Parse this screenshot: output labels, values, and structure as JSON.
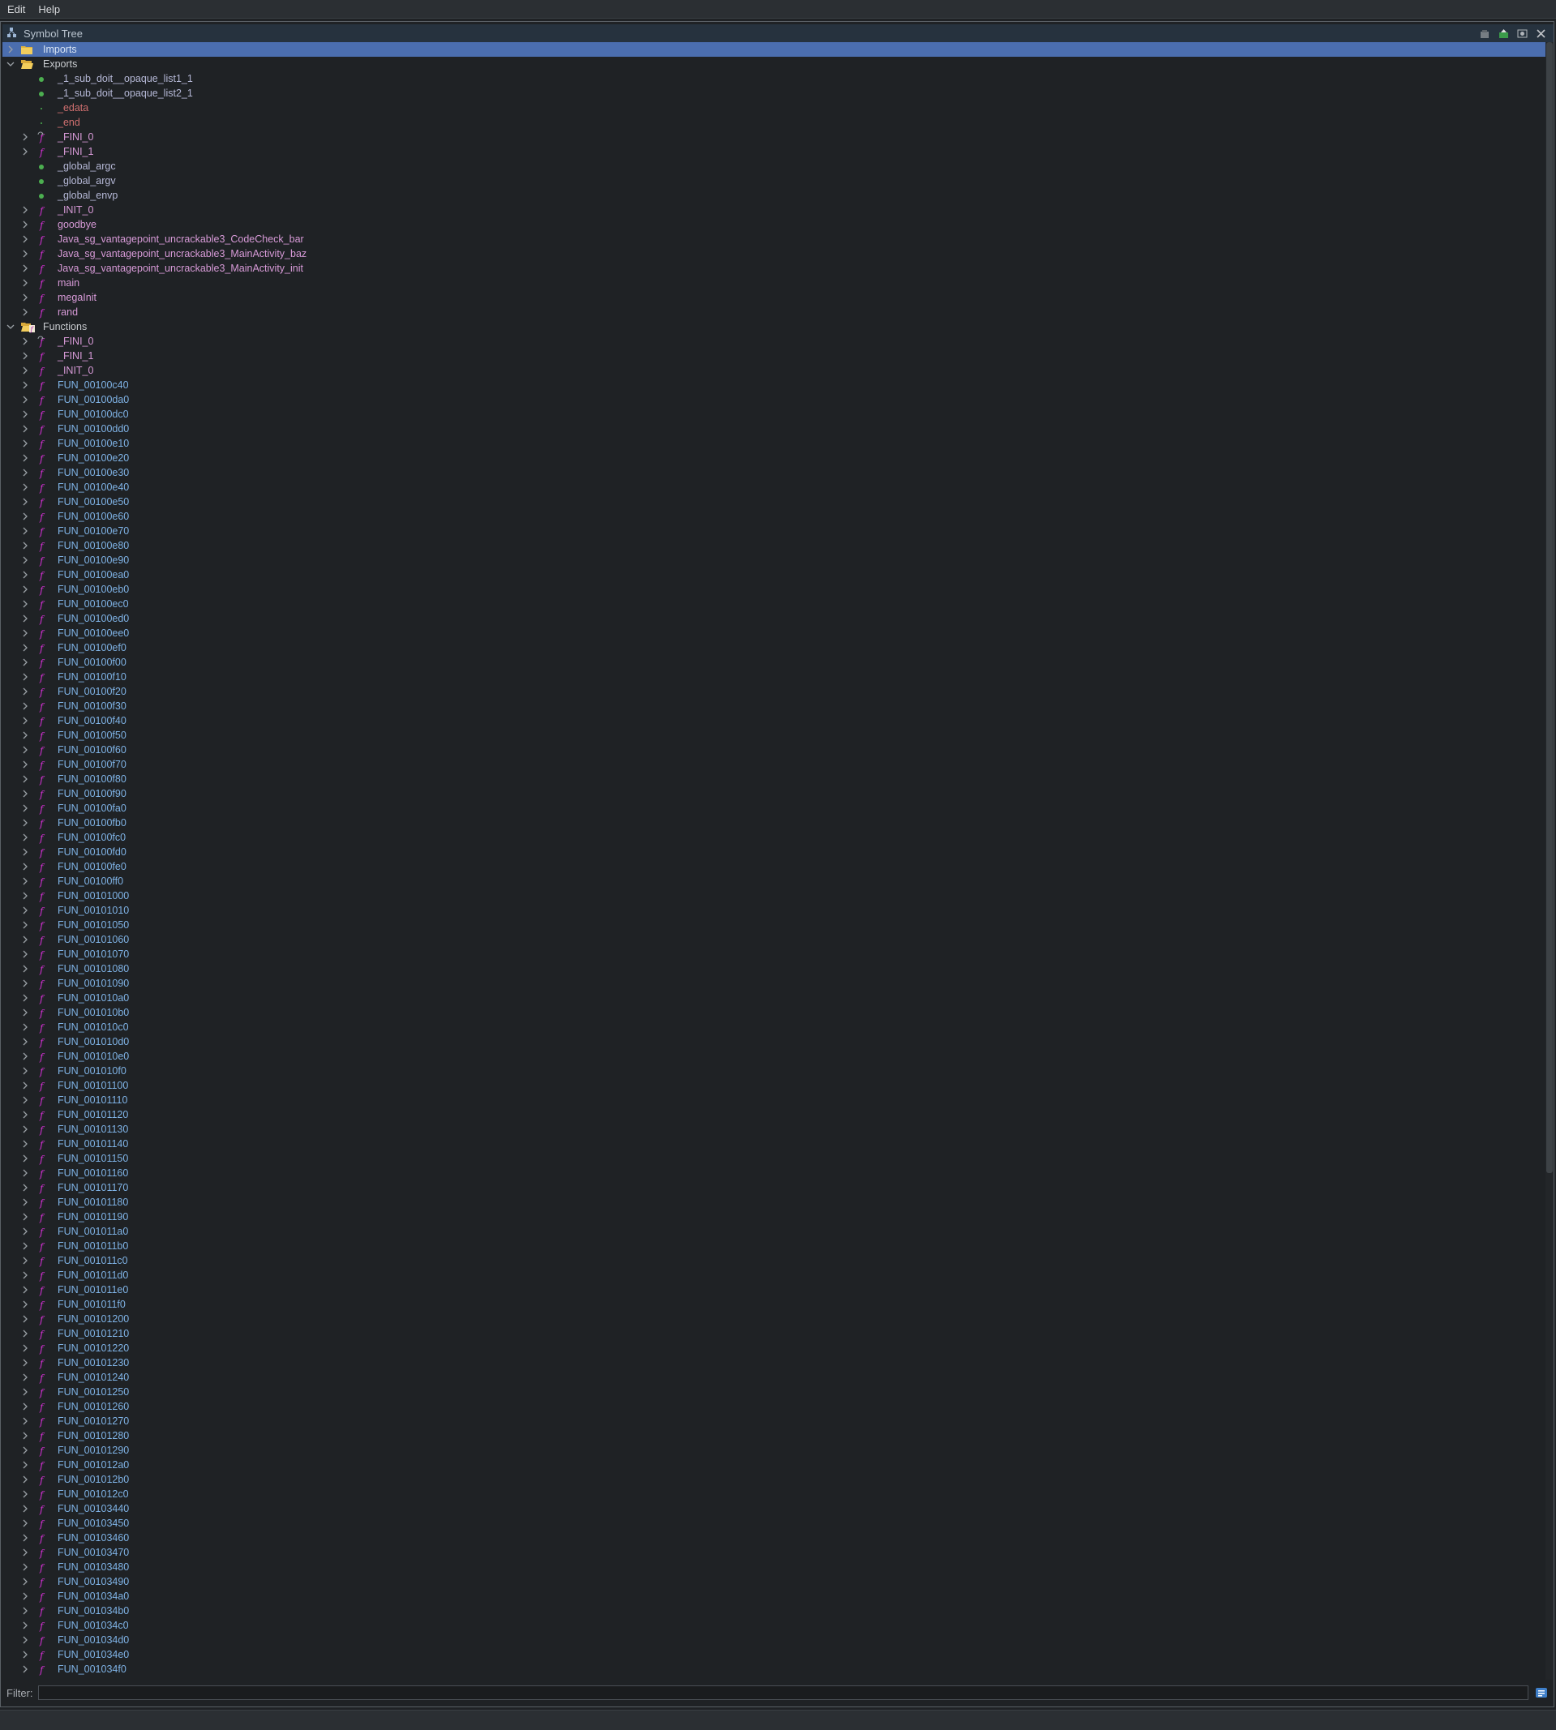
{
  "menu": [
    "Edit",
    "Help"
  ],
  "panel": {
    "title": "Symbol Tree"
  },
  "filter": {
    "label": "Filter:",
    "value": ""
  },
  "colors": {
    "selection": "#4b6eaf",
    "function_icon": "#d030d0",
    "data_dot": "#4caf50",
    "fun_text": "#7fb3e6"
  },
  "tree": [
    {
      "level": 0,
      "label": "Imports",
      "expand": "collapsed",
      "icon": "folder-closed-icon",
      "style": "sel",
      "selected": true
    },
    {
      "level": 0,
      "label": "Exports",
      "expand": "expanded",
      "icon": "folder-open-icon",
      "style": "folder"
    },
    {
      "level": 1,
      "label": "_1_sub_doit__opaque_list1_1",
      "expand": "none",
      "icon": "green-dot-icon",
      "style": "label"
    },
    {
      "level": 1,
      "label": "_1_sub_doit__opaque_list2_1",
      "expand": "none",
      "icon": "green-dot-icon",
      "style": "label"
    },
    {
      "level": 1,
      "label": "_edata",
      "expand": "none",
      "icon": "small-dot-icon",
      "style": "red"
    },
    {
      "level": 1,
      "label": "_end",
      "expand": "none",
      "icon": "small-dot-icon",
      "style": "red"
    },
    {
      "level": 1,
      "label": "_FINI_0",
      "expand": "collapsed",
      "icon": "function-thunk-icon",
      "style": "func"
    },
    {
      "level": 1,
      "label": "_FINI_1",
      "expand": "collapsed",
      "icon": "function-icon",
      "style": "func"
    },
    {
      "level": 1,
      "label": "_global_argc",
      "expand": "none",
      "icon": "green-dot-icon",
      "style": "label"
    },
    {
      "level": 1,
      "label": "_global_argv",
      "expand": "none",
      "icon": "green-dot-icon",
      "style": "label"
    },
    {
      "level": 1,
      "label": "_global_envp",
      "expand": "none",
      "icon": "green-dot-icon",
      "style": "label"
    },
    {
      "level": 1,
      "label": "_INIT_0",
      "expand": "collapsed",
      "icon": "function-icon",
      "style": "func"
    },
    {
      "level": 1,
      "label": "goodbye",
      "expand": "collapsed",
      "icon": "function-icon",
      "style": "func"
    },
    {
      "level": 1,
      "label": "Java_sg_vantagepoint_uncrackable3_CodeCheck_bar",
      "expand": "collapsed",
      "icon": "function-icon",
      "style": "func"
    },
    {
      "level": 1,
      "label": "Java_sg_vantagepoint_uncrackable3_MainActivity_baz",
      "expand": "collapsed",
      "icon": "function-icon",
      "style": "func"
    },
    {
      "level": 1,
      "label": "Java_sg_vantagepoint_uncrackable3_MainActivity_init",
      "expand": "collapsed",
      "icon": "function-icon",
      "style": "func"
    },
    {
      "level": 1,
      "label": "main",
      "expand": "collapsed",
      "icon": "function-icon",
      "style": "func"
    },
    {
      "level": 1,
      "label": "megaInit",
      "expand": "collapsed",
      "icon": "function-icon",
      "style": "func"
    },
    {
      "level": 1,
      "label": "rand",
      "expand": "collapsed",
      "icon": "function-icon",
      "style": "func"
    },
    {
      "level": 0,
      "label": "Functions",
      "expand": "expanded",
      "icon": "functions-folder-icon",
      "style": "folder"
    },
    {
      "level": 1,
      "label": "_FINI_0",
      "expand": "collapsed",
      "icon": "function-thunk-icon",
      "style": "func"
    },
    {
      "level": 1,
      "label": "_FINI_1",
      "expand": "collapsed",
      "icon": "function-icon",
      "style": "func"
    },
    {
      "level": 1,
      "label": "_INIT_0",
      "expand": "collapsed",
      "icon": "function-icon",
      "style": "func"
    },
    {
      "level": 1,
      "label": "FUN_00100c40",
      "expand": "collapsed",
      "icon": "function-icon",
      "style": "fun"
    },
    {
      "level": 1,
      "label": "FUN_00100da0",
      "expand": "collapsed",
      "icon": "function-icon",
      "style": "fun"
    },
    {
      "level": 1,
      "label": "FUN_00100dc0",
      "expand": "collapsed",
      "icon": "function-icon",
      "style": "fun"
    },
    {
      "level": 1,
      "label": "FUN_00100dd0",
      "expand": "collapsed",
      "icon": "function-icon",
      "style": "fun"
    },
    {
      "level": 1,
      "label": "FUN_00100e10",
      "expand": "collapsed",
      "icon": "function-icon",
      "style": "fun"
    },
    {
      "level": 1,
      "label": "FUN_00100e20",
      "expand": "collapsed",
      "icon": "function-icon",
      "style": "fun"
    },
    {
      "level": 1,
      "label": "FUN_00100e30",
      "expand": "collapsed",
      "icon": "function-icon",
      "style": "fun"
    },
    {
      "level": 1,
      "label": "FUN_00100e40",
      "expand": "collapsed",
      "icon": "function-icon",
      "style": "fun"
    },
    {
      "level": 1,
      "label": "FUN_00100e50",
      "expand": "collapsed",
      "icon": "function-icon",
      "style": "fun"
    },
    {
      "level": 1,
      "label": "FUN_00100e60",
      "expand": "collapsed",
      "icon": "function-icon",
      "style": "fun"
    },
    {
      "level": 1,
      "label": "FUN_00100e70",
      "expand": "collapsed",
      "icon": "function-icon",
      "style": "fun"
    },
    {
      "level": 1,
      "label": "FUN_00100e80",
      "expand": "collapsed",
      "icon": "function-icon",
      "style": "fun"
    },
    {
      "level": 1,
      "label": "FUN_00100e90",
      "expand": "collapsed",
      "icon": "function-icon",
      "style": "fun"
    },
    {
      "level": 1,
      "label": "FUN_00100ea0",
      "expand": "collapsed",
      "icon": "function-icon",
      "style": "fun"
    },
    {
      "level": 1,
      "label": "FUN_00100eb0",
      "expand": "collapsed",
      "icon": "function-icon",
      "style": "fun"
    },
    {
      "level": 1,
      "label": "FUN_00100ec0",
      "expand": "collapsed",
      "icon": "function-icon",
      "style": "fun"
    },
    {
      "level": 1,
      "label": "FUN_00100ed0",
      "expand": "collapsed",
      "icon": "function-icon",
      "style": "fun"
    },
    {
      "level": 1,
      "label": "FUN_00100ee0",
      "expand": "collapsed",
      "icon": "function-icon",
      "style": "fun"
    },
    {
      "level": 1,
      "label": "FUN_00100ef0",
      "expand": "collapsed",
      "icon": "function-icon",
      "style": "fun"
    },
    {
      "level": 1,
      "label": "FUN_00100f00",
      "expand": "collapsed",
      "icon": "function-icon",
      "style": "fun"
    },
    {
      "level": 1,
      "label": "FUN_00100f10",
      "expand": "collapsed",
      "icon": "function-icon",
      "style": "fun"
    },
    {
      "level": 1,
      "label": "FUN_00100f20",
      "expand": "collapsed",
      "icon": "function-icon",
      "style": "fun"
    },
    {
      "level": 1,
      "label": "FUN_00100f30",
      "expand": "collapsed",
      "icon": "function-icon",
      "style": "fun"
    },
    {
      "level": 1,
      "label": "FUN_00100f40",
      "expand": "collapsed",
      "icon": "function-icon",
      "style": "fun"
    },
    {
      "level": 1,
      "label": "FUN_00100f50",
      "expand": "collapsed",
      "icon": "function-icon",
      "style": "fun"
    },
    {
      "level": 1,
      "label": "FUN_00100f60",
      "expand": "collapsed",
      "icon": "function-icon",
      "style": "fun"
    },
    {
      "level": 1,
      "label": "FUN_00100f70",
      "expand": "collapsed",
      "icon": "function-icon",
      "style": "fun"
    },
    {
      "level": 1,
      "label": "FUN_00100f80",
      "expand": "collapsed",
      "icon": "function-icon",
      "style": "fun"
    },
    {
      "level": 1,
      "label": "FUN_00100f90",
      "expand": "collapsed",
      "icon": "function-icon",
      "style": "fun"
    },
    {
      "level": 1,
      "label": "FUN_00100fa0",
      "expand": "collapsed",
      "icon": "function-icon",
      "style": "fun"
    },
    {
      "level": 1,
      "label": "FUN_00100fb0",
      "expand": "collapsed",
      "icon": "function-icon",
      "style": "fun"
    },
    {
      "level": 1,
      "label": "FUN_00100fc0",
      "expand": "collapsed",
      "icon": "function-icon",
      "style": "fun"
    },
    {
      "level": 1,
      "label": "FUN_00100fd0",
      "expand": "collapsed",
      "icon": "function-icon",
      "style": "fun"
    },
    {
      "level": 1,
      "label": "FUN_00100fe0",
      "expand": "collapsed",
      "icon": "function-icon",
      "style": "fun"
    },
    {
      "level": 1,
      "label": "FUN_00100ff0",
      "expand": "collapsed",
      "icon": "function-icon",
      "style": "fun"
    },
    {
      "level": 1,
      "label": "FUN_00101000",
      "expand": "collapsed",
      "icon": "function-icon",
      "style": "fun"
    },
    {
      "level": 1,
      "label": "FUN_00101010",
      "expand": "collapsed",
      "icon": "function-icon",
      "style": "fun"
    },
    {
      "level": 1,
      "label": "FUN_00101050",
      "expand": "collapsed",
      "icon": "function-icon",
      "style": "fun"
    },
    {
      "level": 1,
      "label": "FUN_00101060",
      "expand": "collapsed",
      "icon": "function-icon",
      "style": "fun"
    },
    {
      "level": 1,
      "label": "FUN_00101070",
      "expand": "collapsed",
      "icon": "function-icon",
      "style": "fun"
    },
    {
      "level": 1,
      "label": "FUN_00101080",
      "expand": "collapsed",
      "icon": "function-icon",
      "style": "fun"
    },
    {
      "level": 1,
      "label": "FUN_00101090",
      "expand": "collapsed",
      "icon": "function-icon",
      "style": "fun"
    },
    {
      "level": 1,
      "label": "FUN_001010a0",
      "expand": "collapsed",
      "icon": "function-icon",
      "style": "fun"
    },
    {
      "level": 1,
      "label": "FUN_001010b0",
      "expand": "collapsed",
      "icon": "function-icon",
      "style": "fun"
    },
    {
      "level": 1,
      "label": "FUN_001010c0",
      "expand": "collapsed",
      "icon": "function-icon",
      "style": "fun"
    },
    {
      "level": 1,
      "label": "FUN_001010d0",
      "expand": "collapsed",
      "icon": "function-icon",
      "style": "fun"
    },
    {
      "level": 1,
      "label": "FUN_001010e0",
      "expand": "collapsed",
      "icon": "function-icon",
      "style": "fun"
    },
    {
      "level": 1,
      "label": "FUN_001010f0",
      "expand": "collapsed",
      "icon": "function-icon",
      "style": "fun"
    },
    {
      "level": 1,
      "label": "FUN_00101100",
      "expand": "collapsed",
      "icon": "function-icon",
      "style": "fun"
    },
    {
      "level": 1,
      "label": "FUN_00101110",
      "expand": "collapsed",
      "icon": "function-icon",
      "style": "fun"
    },
    {
      "level": 1,
      "label": "FUN_00101120",
      "expand": "collapsed",
      "icon": "function-icon",
      "style": "fun"
    },
    {
      "level": 1,
      "label": "FUN_00101130",
      "expand": "collapsed",
      "icon": "function-icon",
      "style": "fun"
    },
    {
      "level": 1,
      "label": "FUN_00101140",
      "expand": "collapsed",
      "icon": "function-icon",
      "style": "fun"
    },
    {
      "level": 1,
      "label": "FUN_00101150",
      "expand": "collapsed",
      "icon": "function-icon",
      "style": "fun"
    },
    {
      "level": 1,
      "label": "FUN_00101160",
      "expand": "collapsed",
      "icon": "function-icon",
      "style": "fun"
    },
    {
      "level": 1,
      "label": "FUN_00101170",
      "expand": "collapsed",
      "icon": "function-icon",
      "style": "fun"
    },
    {
      "level": 1,
      "label": "FUN_00101180",
      "expand": "collapsed",
      "icon": "function-icon",
      "style": "fun"
    },
    {
      "level": 1,
      "label": "FUN_00101190",
      "expand": "collapsed",
      "icon": "function-icon",
      "style": "fun"
    },
    {
      "level": 1,
      "label": "FUN_001011a0",
      "expand": "collapsed",
      "icon": "function-icon",
      "style": "fun"
    },
    {
      "level": 1,
      "label": "FUN_001011b0",
      "expand": "collapsed",
      "icon": "function-icon",
      "style": "fun"
    },
    {
      "level": 1,
      "label": "FUN_001011c0",
      "expand": "collapsed",
      "icon": "function-icon",
      "style": "fun"
    },
    {
      "level": 1,
      "label": "FUN_001011d0",
      "expand": "collapsed",
      "icon": "function-icon",
      "style": "fun"
    },
    {
      "level": 1,
      "label": "FUN_001011e0",
      "expand": "collapsed",
      "icon": "function-icon",
      "style": "fun"
    },
    {
      "level": 1,
      "label": "FUN_001011f0",
      "expand": "collapsed",
      "icon": "function-icon",
      "style": "fun"
    },
    {
      "level": 1,
      "label": "FUN_00101200",
      "expand": "collapsed",
      "icon": "function-icon",
      "style": "fun"
    },
    {
      "level": 1,
      "label": "FUN_00101210",
      "expand": "collapsed",
      "icon": "function-icon",
      "style": "fun"
    },
    {
      "level": 1,
      "label": "FUN_00101220",
      "expand": "collapsed",
      "icon": "function-icon",
      "style": "fun"
    },
    {
      "level": 1,
      "label": "FUN_00101230",
      "expand": "collapsed",
      "icon": "function-icon",
      "style": "fun"
    },
    {
      "level": 1,
      "label": "FUN_00101240",
      "expand": "collapsed",
      "icon": "function-icon",
      "style": "fun"
    },
    {
      "level": 1,
      "label": "FUN_00101250",
      "expand": "collapsed",
      "icon": "function-icon",
      "style": "fun"
    },
    {
      "level": 1,
      "label": "FUN_00101260",
      "expand": "collapsed",
      "icon": "function-icon",
      "style": "fun"
    },
    {
      "level": 1,
      "label": "FUN_00101270",
      "expand": "collapsed",
      "icon": "function-icon",
      "style": "fun"
    },
    {
      "level": 1,
      "label": "FUN_00101280",
      "expand": "collapsed",
      "icon": "function-icon",
      "style": "fun"
    },
    {
      "level": 1,
      "label": "FUN_00101290",
      "expand": "collapsed",
      "icon": "function-icon",
      "style": "fun"
    },
    {
      "level": 1,
      "label": "FUN_001012a0",
      "expand": "collapsed",
      "icon": "function-icon",
      "style": "fun"
    },
    {
      "level": 1,
      "label": "FUN_001012b0",
      "expand": "collapsed",
      "icon": "function-icon",
      "style": "fun"
    },
    {
      "level": 1,
      "label": "FUN_001012c0",
      "expand": "collapsed",
      "icon": "function-icon",
      "style": "fun"
    },
    {
      "level": 1,
      "label": "FUN_00103440",
      "expand": "collapsed",
      "icon": "function-icon",
      "style": "fun"
    },
    {
      "level": 1,
      "label": "FUN_00103450",
      "expand": "collapsed",
      "icon": "function-icon",
      "style": "fun"
    },
    {
      "level": 1,
      "label": "FUN_00103460",
      "expand": "collapsed",
      "icon": "function-icon",
      "style": "fun"
    },
    {
      "level": 1,
      "label": "FUN_00103470",
      "expand": "collapsed",
      "icon": "function-icon",
      "style": "fun"
    },
    {
      "level": 1,
      "label": "FUN_00103480",
      "expand": "collapsed",
      "icon": "function-icon",
      "style": "fun"
    },
    {
      "level": 1,
      "label": "FUN_00103490",
      "expand": "collapsed",
      "icon": "function-icon",
      "style": "fun"
    },
    {
      "level": 1,
      "label": "FUN_001034a0",
      "expand": "collapsed",
      "icon": "function-icon",
      "style": "fun"
    },
    {
      "level": 1,
      "label": "FUN_001034b0",
      "expand": "collapsed",
      "icon": "function-icon",
      "style": "fun"
    },
    {
      "level": 1,
      "label": "FUN_001034c0",
      "expand": "collapsed",
      "icon": "function-icon",
      "style": "fun"
    },
    {
      "level": 1,
      "label": "FUN_001034d0",
      "expand": "collapsed",
      "icon": "function-icon",
      "style": "fun"
    },
    {
      "level": 1,
      "label": "FUN_001034e0",
      "expand": "collapsed",
      "icon": "function-icon",
      "style": "fun"
    },
    {
      "level": 1,
      "label": "FUN_001034f0",
      "expand": "collapsed",
      "icon": "function-icon",
      "style": "fun"
    }
  ]
}
